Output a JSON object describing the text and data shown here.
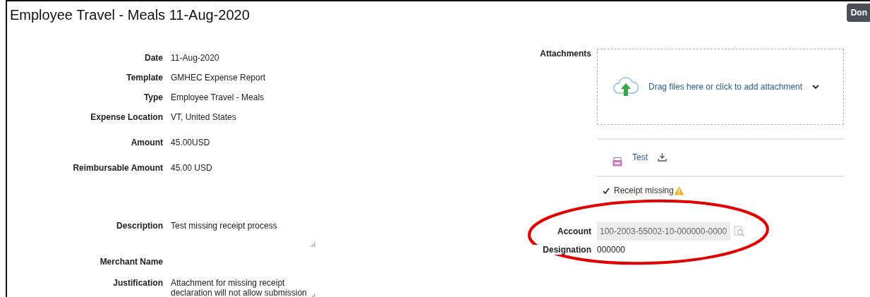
{
  "title": "Employee Travel - Meals 11-Aug-2020",
  "top_button": {
    "label": "Don"
  },
  "fields": [
    {
      "kind": "text",
      "label": "Date",
      "value": "11-Aug-2020"
    },
    {
      "kind": "text",
      "label": "Template",
      "value": "GMHEC Expense Report"
    },
    {
      "kind": "text",
      "label": "Type",
      "value": "Employee Travel - Meals"
    },
    {
      "kind": "text",
      "label": "Expense Location",
      "value": "VT, United States"
    },
    {
      "kind": "text",
      "label": "Amount",
      "value": "45.00USD"
    },
    {
      "kind": "text",
      "label": "Reimbursable Amount",
      "value": "45.00 USD"
    },
    {
      "kind": "textarea",
      "label": "Description",
      "value": "Test missing receipt process"
    },
    {
      "kind": "text",
      "label": "Merchant Name"
    },
    {
      "kind": "textarea",
      "label": "Justification",
      "value": "Attachment for missing receipt declaration will not allow submission"
    }
  ],
  "attachments": {
    "label": "Attachments",
    "dropzone": "Drag files here or click to add attachment",
    "files": [
      {
        "name": "Test"
      }
    ]
  },
  "receipt_missing": {
    "label": "Receipt missing",
    "checked": true,
    "warning": true
  },
  "account": {
    "label": "Account",
    "value": "100-2003-55002-10-000000-0000",
    "disabled": true
  },
  "designation": {
    "label": "Designation",
    "value": "000000"
  },
  "annotation": {
    "color": "#e00000"
  }
}
